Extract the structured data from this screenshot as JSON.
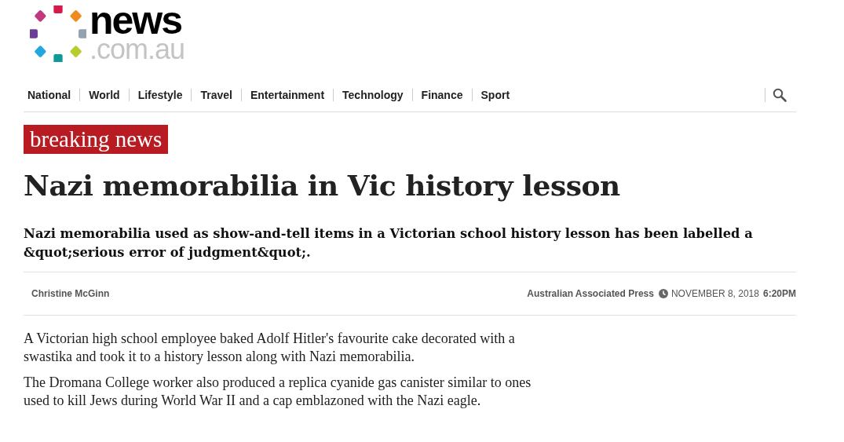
{
  "logo": {
    "word": "news",
    "domain": ".com.au"
  },
  "nav": {
    "items": [
      {
        "label": "National"
      },
      {
        "label": "World"
      },
      {
        "label": "Lifestyle"
      },
      {
        "label": "Travel"
      },
      {
        "label": "Entertainment"
      },
      {
        "label": "Technology"
      },
      {
        "label": "Finance"
      },
      {
        "label": "Sport"
      }
    ]
  },
  "article": {
    "badge": "breaking news",
    "headline": "Nazi memorabilia in Vic history lesson",
    "standfirst": "Nazi memorabilia used as show-and-tell items in a Victorian school history lesson has been labelled a &quot;serious error of judgment&quot;.",
    "author": "Christine McGinn",
    "source": "Australian Associated Press",
    "date": "NOVEMBER 8, 2018",
    "time": "6:20PM",
    "paragraphs": [
      "A Victorian high school employee baked Adolf Hitler's favourite cake decorated with a swastika and took it to a history lesson along with Nazi memorabilia.",
      "The Dromana College worker also produced a replica cyanide gas canister similar to ones used to kill Jews during World War II and a cap emblazoned with the Nazi eagle."
    ]
  }
}
